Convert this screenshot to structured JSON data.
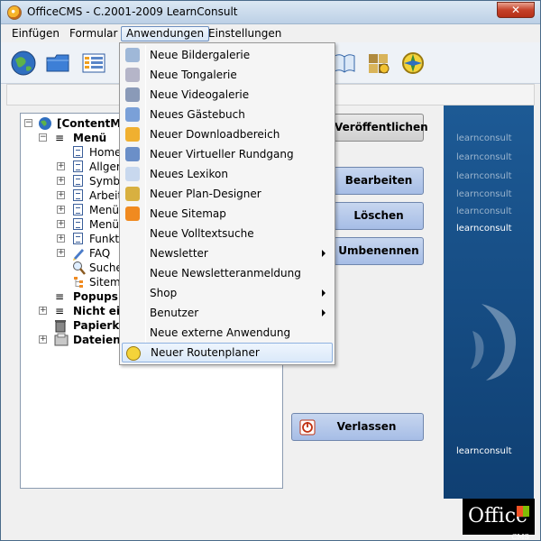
{
  "window": {
    "title": "OfficeCMS - C.2001-2009 LearnConsult",
    "close_label": "✕"
  },
  "menubar": {
    "items": [
      "Einfügen",
      "Formular",
      "Anwendungen",
      "Einstellungen"
    ]
  },
  "toolbar": {
    "icons": [
      "globe-icon",
      "folder-icon",
      "list-icon",
      "book-icon",
      "puzzle-icon",
      "compass-icon"
    ]
  },
  "tree": {
    "root": "[ContentMar",
    "menu": "Menü",
    "items": [
      "Home",
      "Allgem",
      "Symbo",
      "Arbeits",
      "Menüle",
      "Menüp",
      "Funktic",
      "FAQ",
      "Suche",
      "Sitema"
    ],
    "popups": "Popups",
    "nicht": "Nicht ein",
    "papierkorb": "Papierko",
    "dateien": "Dateien"
  },
  "buttons": {
    "publish": "Veröffentlichen",
    "edit": "Bearbeiten",
    "delete": "Löschen",
    "rename": "Umbenennen",
    "exit": "Verlassen"
  },
  "side_panel": {
    "brand": "learnconsult"
  },
  "logo": {
    "office": "Office",
    "cms": "CMS"
  },
  "dropdown": {
    "items": [
      {
        "label": "Neue Bildergalerie",
        "icon": "image-gallery-icon",
        "submenu": false
      },
      {
        "label": "Neue Tongalerie",
        "icon": "audio-icon",
        "submenu": false
      },
      {
        "label": "Neue Videogalerie",
        "icon": "video-icon",
        "submenu": false
      },
      {
        "label": "Neues Gästebuch",
        "icon": "guestbook-icon",
        "submenu": false
      },
      {
        "label": "Neuer Downloadbereich",
        "icon": "download-icon",
        "submenu": false
      },
      {
        "label": "Neuer Virtueller Rundgang",
        "icon": "virtual-tour-icon",
        "submenu": false
      },
      {
        "label": "Neues Lexikon",
        "icon": "lexicon-icon",
        "submenu": false
      },
      {
        "label": "Neuer Plan-Designer",
        "icon": "plan-designer-icon",
        "submenu": false
      },
      {
        "label": "Neue Sitemap",
        "icon": "sitemap-icon",
        "submenu": false
      },
      {
        "label": "Neue Volltextsuche",
        "icon": "",
        "submenu": false
      },
      {
        "label": "Newsletter",
        "icon": "",
        "submenu": true
      },
      {
        "label": "Neue Newsletteranmeldung",
        "icon": "",
        "submenu": false
      },
      {
        "label": "Shop",
        "icon": "",
        "submenu": true
      },
      {
        "label": "Benutzer",
        "icon": "",
        "submenu": true
      },
      {
        "label": "Neue externe Anwendung",
        "icon": "",
        "submenu": false
      },
      {
        "label": "Neuer Routenplaner",
        "icon": "route-planner-icon",
        "submenu": false
      }
    ]
  }
}
